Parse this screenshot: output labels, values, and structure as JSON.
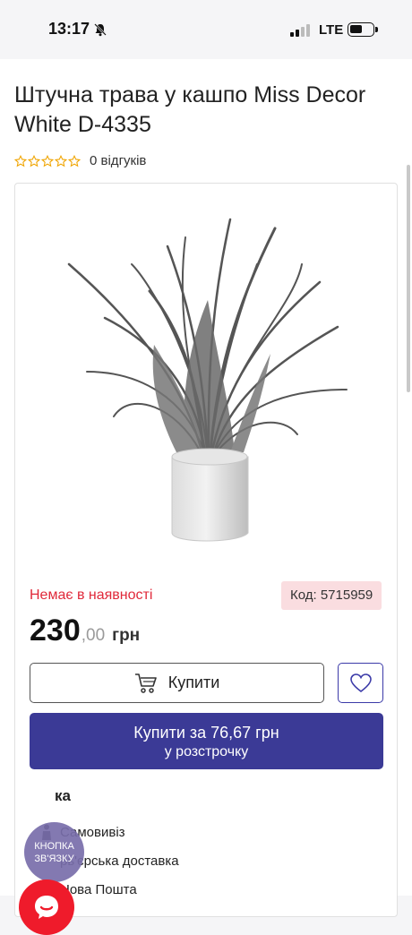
{
  "status_bar": {
    "time": "13:17",
    "network": "LTE"
  },
  "product": {
    "title": "Штучна трава у кашпо Miss Decor White D-4335",
    "reviews": "0 відгуків",
    "rating_stars": 0,
    "stock": "Немає в наявності",
    "code": "Код: 5715959",
    "price_main": "230",
    "price_cents": ",00",
    "price_currency": "грн"
  },
  "actions": {
    "buy_label": "Купити",
    "installment_line1": "Купити за 76,67 грн",
    "installment_line2": "у розстрочку"
  },
  "delivery": {
    "title": "ка",
    "items": [
      {
        "label": "Самовивіз",
        "icon": "person-icon"
      },
      {
        "label": "рь'єрська доставка",
        "icon": "courier-icon"
      },
      {
        "label": "Нова Пошта",
        "icon": "nova-poshta-icon"
      }
    ]
  },
  "floating": {
    "contact_line1": "КНОПКА",
    "contact_line2": "ЗВ'ЯЗКУ"
  },
  "colors": {
    "accent": "#3b3a96",
    "error": "#e0293a",
    "badge_bg": "#fadde0",
    "star": "#f0a400",
    "chat": "#ef1b2b"
  }
}
